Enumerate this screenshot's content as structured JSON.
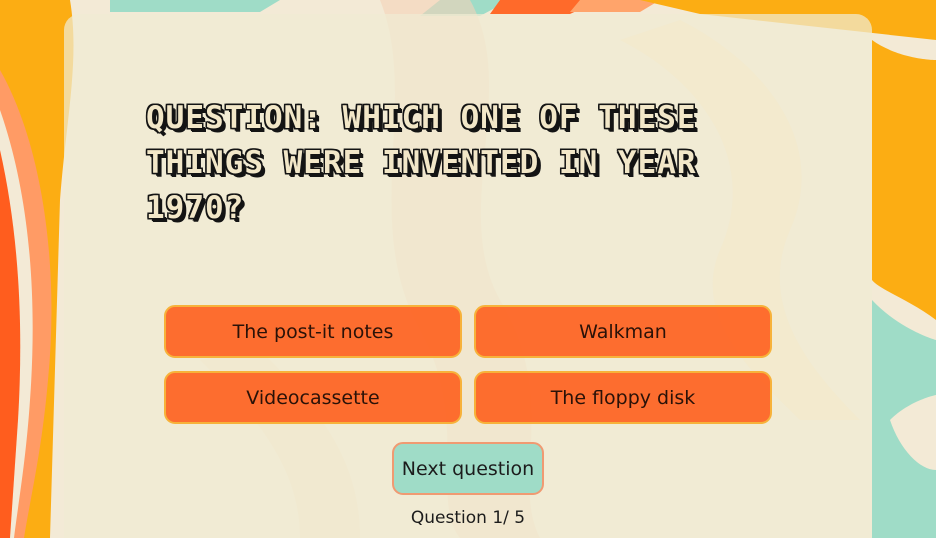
{
  "quiz": {
    "question": "Question: Which one of these things were invented in year 1970?",
    "answers": [
      "The post-it notes",
      "Walkman",
      "Videocassette",
      "The floppy disk"
    ],
    "next_button": "Next question",
    "counter": "Question 1/ 5"
  },
  "colors": {
    "background": "#f3ead6",
    "orange": "#ff5d1e",
    "yellow": "#fcad13",
    "mint": "#9fdcc7",
    "peach": "#ff9b65"
  }
}
